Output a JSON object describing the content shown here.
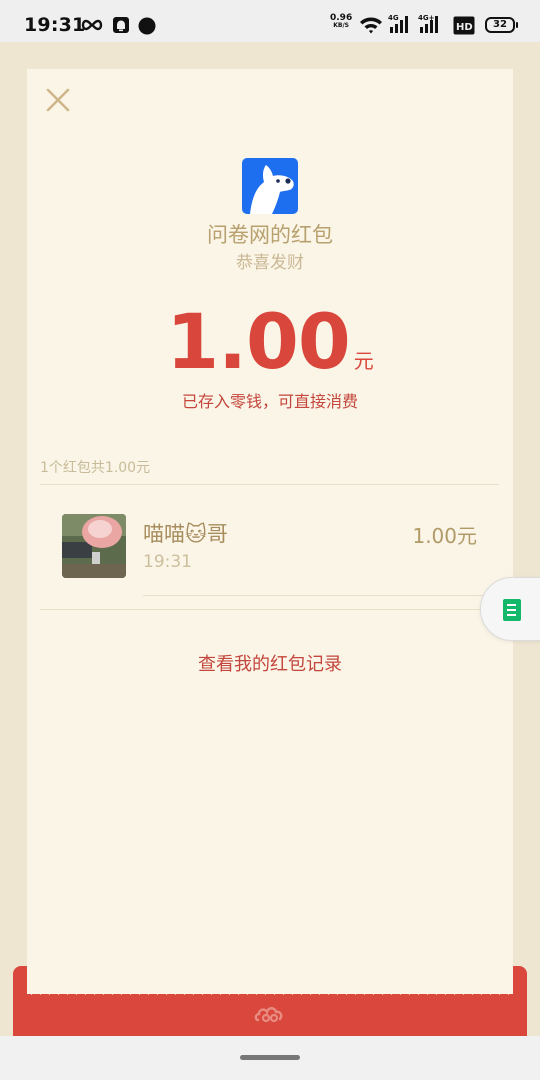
{
  "status_bar": {
    "time": "19:31",
    "net_speed_value": "0.96",
    "net_speed_unit": "KB/S",
    "battery": "32",
    "icons": [
      "infinity-icon",
      "notification-icon",
      "dot-icon",
      "wifi-icon",
      "signal-4g-icon",
      "signal-4g-plus-icon",
      "hd-icon",
      "battery-icon"
    ]
  },
  "packet": {
    "sender_name": "问卷网的红包",
    "greeting": "恭喜发财",
    "amount": "1.00",
    "unit": "元",
    "note": "已存入零钱，可直接消费",
    "summary": "1个红包共1.00元"
  },
  "receivers": [
    {
      "name": "喵喵🐱哥",
      "time": "19:31",
      "amount": "1.00元"
    }
  ],
  "links": {
    "records": "查看我的红包记录"
  },
  "colors": {
    "page_bg": "#efe6d2",
    "card_bg": "#faf5e7",
    "red": "#d9463b",
    "gold_text": "#b8a16e",
    "logo_blue": "#1e6ef0",
    "float_green": "#14b86a"
  }
}
